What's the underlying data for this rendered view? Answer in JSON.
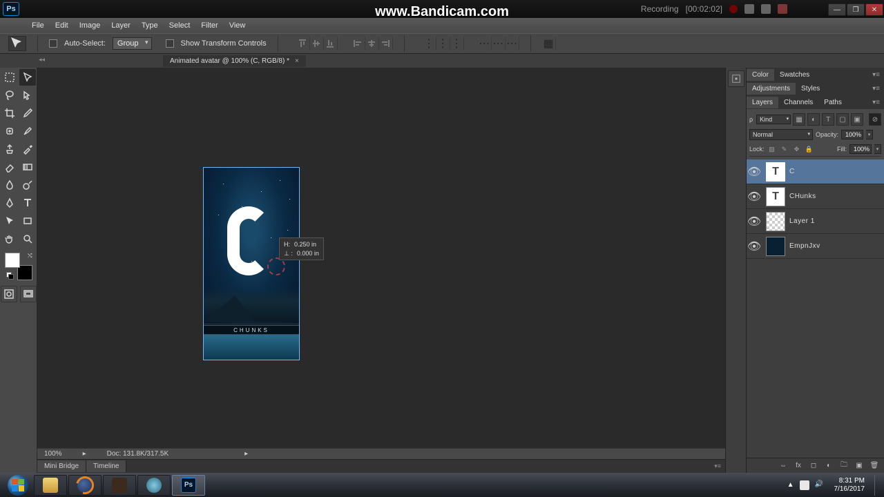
{
  "watermark": "www.Bandicam.com",
  "recording": {
    "label": "Recording",
    "time": "[00:02:02]"
  },
  "menu": {
    "file": "File",
    "edit": "Edit",
    "image": "Image",
    "layer": "Layer",
    "type": "Type",
    "select": "Select",
    "filter": "Filter",
    "view": "View"
  },
  "ps_badge": "Ps",
  "options": {
    "auto_select": "Auto-Select:",
    "group": "Group",
    "show_transform": "Show Transform Controls"
  },
  "doc_tab": "Animated avatar @ 100% (C, RGB/8) *",
  "artwork": {
    "big_letter": "C",
    "caption": "CHUNKS"
  },
  "measure": {
    "h_label": "H:",
    "h_val": "0.250 in",
    "v_label": "⊥ :",
    "v_val": "0.000 in"
  },
  "status": {
    "zoom": "100%",
    "doc": "Doc: 131.8K/317.5K"
  },
  "bottom_tabs": {
    "mb": "Mini Bridge",
    "tl": "Timeline"
  },
  "panels": {
    "color": "Color",
    "swatches": "Swatches",
    "adjustments": "Adjustments",
    "styles": "Styles",
    "layers": "Layers",
    "channels": "Channels",
    "paths": "Paths",
    "kind": "Kind",
    "blend": "Normal",
    "opacity_lbl": "Opacity:",
    "opacity_val": "100%",
    "lock_lbl": "Lock:",
    "fill_lbl": "Fill:",
    "fill_val": "100%",
    "layers_list": [
      {
        "name": "C",
        "type": "text"
      },
      {
        "name": "CHunks",
        "type": "text"
      },
      {
        "name": "Layer 1",
        "type": "trans"
      },
      {
        "name": "EmpnJxv",
        "type": "img"
      }
    ]
  },
  "tray": {
    "time": "8:31 PM",
    "date": "7/16/2017",
    "show_hidden": "▲"
  }
}
